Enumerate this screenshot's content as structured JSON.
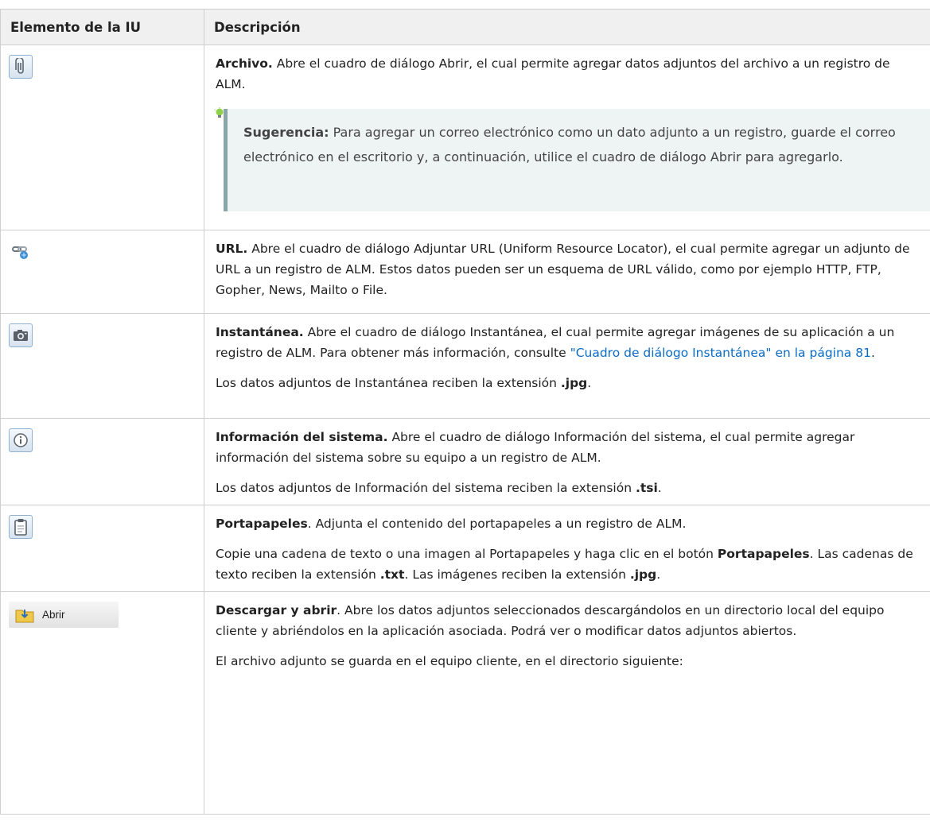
{
  "table": {
    "headers": [
      "Elemento de la IU",
      "Descripción"
    ],
    "rows": [
      {
        "icon": "paperclip-icon",
        "title": "Archivo.",
        "text": " Abre el cuadro de diálogo Abrir, el cual permite agregar datos adjuntos del archivo a un registro de ALM.",
        "tip_label": "Sugerencia:",
        "tip_text": " Para agregar un correo electrónico como un dato adjunto a un registro, guarde el correo electrónico en el escritorio y, a continuación, utilice el cuadro de diálogo Abrir para agregarlo."
      },
      {
        "icon": "url-chain-icon",
        "title": "URL.",
        "text": " Abre el cuadro de diálogo Adjuntar URL (Uniform Resource Locator), el cual permite agregar un adjunto de URL a un registro de ALM. Estos datos pueden ser un esquema de URL válido, como por ejemplo HTTP, FTP, Gopher, News, Mailto o File."
      },
      {
        "icon": "camera-icon",
        "title": "Instantánea.",
        "text": " Abre el cuadro de diálogo Instantánea, el cual permite agregar imágenes de su aplicación a un registro de ALM. Para obtener más información, consulte ",
        "link": "\"Cuadro de diálogo Instantánea\" en la página 81",
        "text_end": ".",
        "p2_text": "Los datos adjuntos de Instantánea reciben la extensión ",
        "p2_bold": ".jpg",
        "p2_end": "."
      },
      {
        "icon": "info-icon",
        "title": "Información del sistema.",
        "text": " Abre el cuadro de diálogo Información del sistema, el cual permite agregar información del sistema sobre su equipo a un registro de ALM.",
        "p2_text": "Los datos adjuntos de Información del sistema reciben la extensión ",
        "p2_bold": ".tsi",
        "p2_end": "."
      },
      {
        "icon": "clipboard-icon",
        "title": "Portapapeles",
        "text": ". Adjunta el contenido del portapapeles a un registro de ALM.",
        "p2_a": "Copie una cadena de texto o una imagen al Portapapeles y haga clic en el botón ",
        "p2_b": "Portapapeles",
        "p2_c": ". Las cadenas de texto reciben la extensión ",
        "p2_d": ".txt",
        "p2_e": ". Las imágenes reciben la extensión ",
        "p2_f": ".jpg",
        "p2_g": "."
      },
      {
        "icon": "download-open-icon",
        "button_label": "Abrir",
        "title": "Descargar y abrir",
        "text": ". Abre los datos adjuntos seleccionados descargándolos en un directorio local del equipo cliente y abriéndolos en la aplicación asociada. Podrá ver o modificar datos adjuntos abiertos.",
        "p2_text": "El archivo adjunto se guarda en el equipo cliente, en el directorio siguiente:"
      }
    ]
  }
}
